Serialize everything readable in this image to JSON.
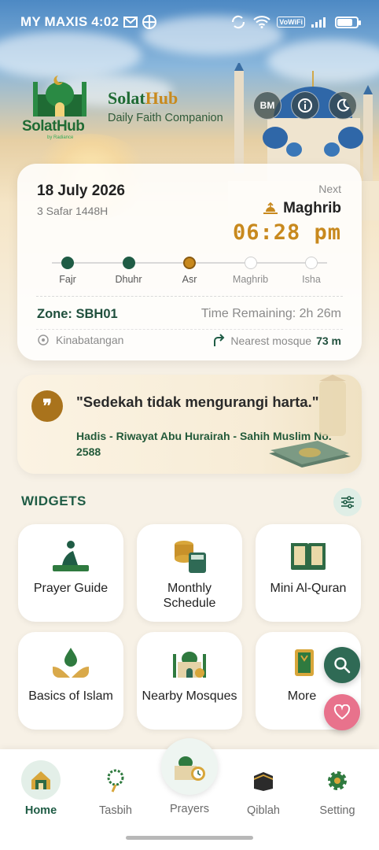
{
  "status_bar": {
    "carrier_time": "MY MAXIS 4:02",
    "vowifi": "VoWiFi",
    "icons": [
      "gmail-icon",
      "app-icon",
      "sync-icon",
      "wifi-icon",
      "signal-icon",
      "battery-icon"
    ],
    "battery_level": 0.8
  },
  "header": {
    "logo_text": "SolatHub",
    "logo_sub": "by Radiance",
    "brand_part1": "Solat",
    "brand_part2": "Hub",
    "tagline": "Daily Faith Companion",
    "lang_button": "BM",
    "icons": [
      "info-icon",
      "moon-icon"
    ]
  },
  "prayer": {
    "date": "18 July 2026",
    "hijri": "3 Safar 1448H",
    "next_label": "Next",
    "next_name": "Maghrib",
    "next_time": "06:28 pm",
    "timeline": [
      {
        "name": "Fajr",
        "state": "done"
      },
      {
        "name": "Dhuhr",
        "state": "done"
      },
      {
        "name": "Asr",
        "state": "current"
      },
      {
        "name": "Maghrib",
        "state": "upcoming"
      },
      {
        "name": "Isha",
        "state": "upcoming"
      }
    ],
    "zone": "Zone: SBH01",
    "remaining": "Time Remaining: 2h 26m",
    "location": "Kinabatangan",
    "nearest_label": "Nearest mosque",
    "nearest_distance": "73 m"
  },
  "quote": {
    "badge": "❞",
    "text": "\"Sedekah tidak mengurangi harta.\"",
    "source": "Hadis - Riwayat Abu Hurairah - Sahih Muslim No. 2588"
  },
  "widgets": {
    "title": "WIDGETS",
    "tiles": [
      {
        "label": "Prayer Guide",
        "icon": "prayer-mat-icon"
      },
      {
        "label": "Monthly Schedule",
        "icon": "coins-calculator-icon"
      },
      {
        "label": "Mini Al-Quran",
        "icon": "quran-book-icon"
      },
      {
        "label": "Basics of Islam",
        "icon": "hands-drop-icon"
      },
      {
        "label": "Nearby Mosques",
        "icon": "mosque-pin-icon"
      },
      {
        "label": "More",
        "icon": "book-icon"
      }
    ]
  },
  "nav": {
    "items": [
      {
        "label": "Home",
        "icon": "home-mosque-icon",
        "active": true
      },
      {
        "label": "Tasbih",
        "icon": "tasbih-beads-icon",
        "active": false
      },
      {
        "label": "Prayers",
        "icon": "mosque-clock-icon",
        "active": false
      },
      {
        "label": "Qiblah",
        "icon": "kaaba-icon",
        "active": false
      },
      {
        "label": "Setting",
        "icon": "gear-icon",
        "active": false
      }
    ]
  },
  "colors": {
    "primary_green": "#1f5c45",
    "gold": "#c8891e",
    "heart_pink": "#e8728c"
  }
}
